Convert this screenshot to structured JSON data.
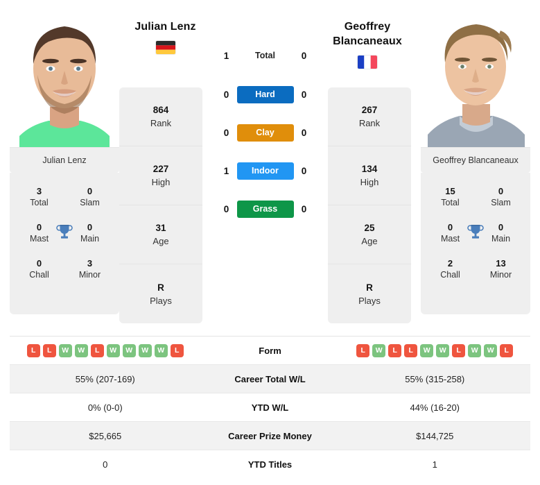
{
  "players": {
    "left": {
      "name": "Julian Lenz",
      "photo_caption": "Julian Lenz",
      "country": "Germany",
      "flag_icon": "flag-germany-icon",
      "stats": [
        {
          "value": "864",
          "label": "Rank"
        },
        {
          "value": "227",
          "label": "High"
        },
        {
          "value": "31",
          "label": "Age"
        },
        {
          "value": "R",
          "label": "Plays"
        }
      ],
      "titles": [
        {
          "value": "3",
          "label": "Total"
        },
        {
          "value": "0",
          "label": "Slam"
        },
        {
          "value": "0",
          "label": "Mast"
        },
        {
          "value": "0",
          "label": "Main"
        },
        {
          "value": "0",
          "label": "Chall"
        },
        {
          "value": "3",
          "label": "Minor"
        }
      ],
      "form": [
        "L",
        "L",
        "W",
        "W",
        "L",
        "W",
        "W",
        "W",
        "W",
        "L"
      ]
    },
    "right": {
      "name": "Geoffrey Blancaneaux",
      "photo_caption": "Geoffrey Blancaneaux",
      "country": "France",
      "flag_icon": "flag-france-icon",
      "stats": [
        {
          "value": "267",
          "label": "Rank"
        },
        {
          "value": "134",
          "label": "High"
        },
        {
          "value": "25",
          "label": "Age"
        },
        {
          "value": "R",
          "label": "Plays"
        }
      ],
      "titles": [
        {
          "value": "15",
          "label": "Total"
        },
        {
          "value": "0",
          "label": "Slam"
        },
        {
          "value": "0",
          "label": "Mast"
        },
        {
          "value": "0",
          "label": "Main"
        },
        {
          "value": "2",
          "label": "Chall"
        },
        {
          "value": "13",
          "label": "Minor"
        }
      ],
      "form": [
        "L",
        "W",
        "L",
        "L",
        "W",
        "W",
        "L",
        "W",
        "W",
        "L"
      ]
    }
  },
  "head_to_head": [
    {
      "label": "Total",
      "left": "1",
      "right": "0",
      "color": "",
      "style": "plain"
    },
    {
      "label": "Hard",
      "left": "0",
      "right": "0",
      "color": "#0b6cc0",
      "style": "bar"
    },
    {
      "label": "Clay",
      "left": "0",
      "right": "0",
      "color": "#e08e0b",
      "style": "bar"
    },
    {
      "label": "Indoor",
      "left": "1",
      "right": "0",
      "color": "#2196f3",
      "style": "bar"
    },
    {
      "label": "Grass",
      "left": "0",
      "right": "0",
      "color": "#0e9648",
      "style": "bar"
    }
  ],
  "trophy_icon": "trophy-icon",
  "comparison_rows": [
    {
      "label": "Form",
      "type": "form",
      "left": "",
      "right": ""
    },
    {
      "label": "Career Total W/L",
      "type": "text",
      "left": "55% (207-169)",
      "right": "55% (315-258)"
    },
    {
      "label": "YTD W/L",
      "type": "text",
      "left": "0% (0-0)",
      "right": "44% (16-20)"
    },
    {
      "label": "Career Prize Money",
      "type": "text",
      "left": "$25,665",
      "right": "$144,725"
    },
    {
      "label": "YTD Titles",
      "type": "text",
      "left": "0",
      "right": "1"
    }
  ],
  "colors": {
    "hard": "#0b6cc0",
    "clay": "#e08e0b",
    "indoor": "#2196f3",
    "grass": "#0e9648",
    "win_badge": "#7cc47f",
    "loss_badge": "#ef553f",
    "trophy": "#4a7ebb",
    "panel_bg": "#efefef"
  }
}
